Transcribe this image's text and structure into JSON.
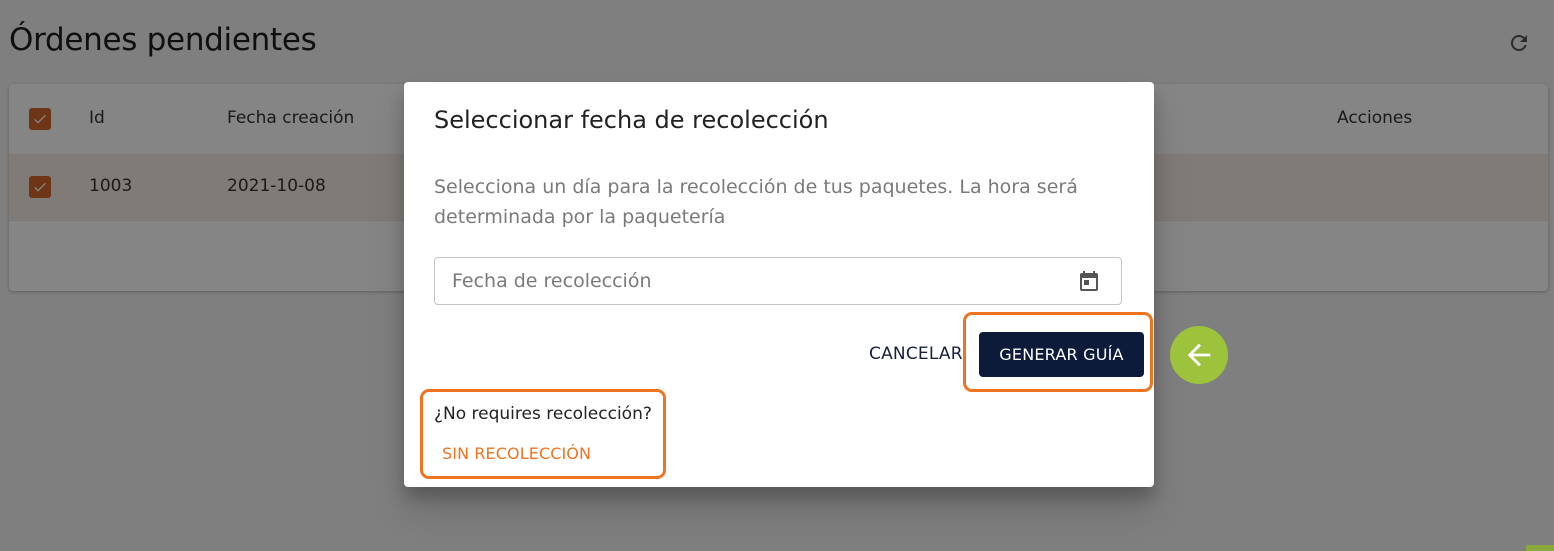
{
  "page": {
    "title": "Órdenes pendientes",
    "refresh_icon": "refresh-icon"
  },
  "table": {
    "columns": {
      "id": "Id",
      "created": "Fecha creación",
      "actions": "Acciones"
    },
    "rows": [
      {
        "id": "1003",
        "created": "2021-10-08",
        "selected": true
      }
    ],
    "select_all": true
  },
  "dialog": {
    "title": "Seleccionar fecha de recolección",
    "description": "Selecciona un día para la recolección de tus paquetes. La hora será determinada por la paquetería",
    "date_field": {
      "placeholder": "Fecha de recolección",
      "value": "",
      "icon": "calendar-icon"
    },
    "cancel_label": "CANCELAR",
    "generate_label": "GENERAR GUÍA",
    "no_pickup_question": "¿No requires recolección?",
    "no_pickup_label": "SIN RECOLECCIÓN"
  },
  "colors": {
    "accent_orange": "#f07321",
    "checkbox_orange": "#d4692c",
    "primary_navy": "#0c1b3a",
    "pointer_green": "#9cc33b"
  },
  "annotations": {
    "pointer_icon": "arrow-left-icon"
  }
}
